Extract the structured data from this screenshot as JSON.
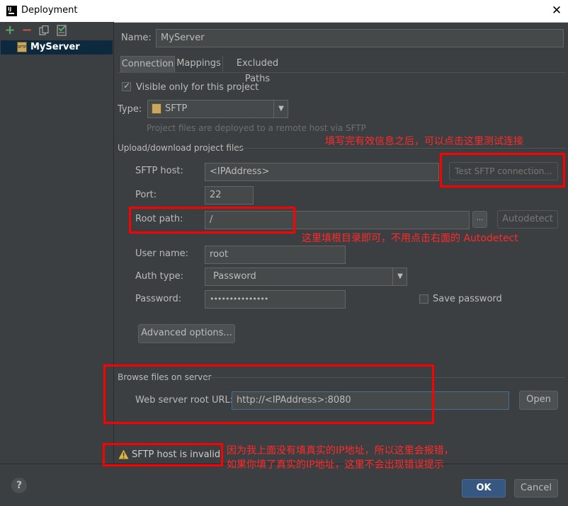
{
  "window": {
    "title": "Deployment",
    "close_glyph": "✕"
  },
  "toolbar": {
    "add": "+",
    "remove": "−"
  },
  "servers": [
    {
      "name": "MyServer"
    }
  ],
  "form": {
    "name_label": "Name:",
    "name_value": "MyServer",
    "tabs": [
      "Connection",
      "Mappings",
      "Excluded Paths"
    ],
    "visible_only_label": "Visible only for this project",
    "type_label": "Type:",
    "type_value": "SFTP",
    "type_desc": "Project files are deployed to a remote host via SFTP",
    "upload_section": "Upload/download project files",
    "sftp_host_label": "SFTP host:",
    "sftp_host_value": "<IPAddress>",
    "test_button": "Test SFTP connection...",
    "port_label": "Port:",
    "port_value": "22",
    "root_path_label": "Root path:",
    "root_path_value": "/",
    "browse_button": "...",
    "autodetect_button": "Autodetect",
    "user_label": "User name:",
    "user_value": "root",
    "auth_label": "Auth type:",
    "auth_value": "Password",
    "password_label": "Password:",
    "password_value": "•••••••••••••••",
    "save_password_label": "Save password",
    "advanced_button": "Advanced options...",
    "browse_section": "Browse files on server",
    "web_root_label": "Web server root URL:",
    "web_root_value": "http://<IPAddress>:8080",
    "open_button": "Open",
    "error_text": "SFTP host is invalid"
  },
  "footer": {
    "help": "?",
    "ok": "OK",
    "cancel": "Cancel"
  },
  "annotations": {
    "test_hint": "填写完有效信息之后，可以点击这里测试连接",
    "root_hint": "这里填根目录即可，不用点击右面的 Autodetect",
    "error_hint_1": "因为我上面没有填真实的IP地址，所以这里会报错，",
    "error_hint_2": "如果你填了真实的IP地址，这里不会出现错误提示"
  },
  "colors": {
    "accent_red": "#ff0000",
    "ok_blue": "#365880",
    "add_green": "#59a869",
    "remove_red": "#c75450",
    "warning_yellow": "#e2b33c"
  }
}
